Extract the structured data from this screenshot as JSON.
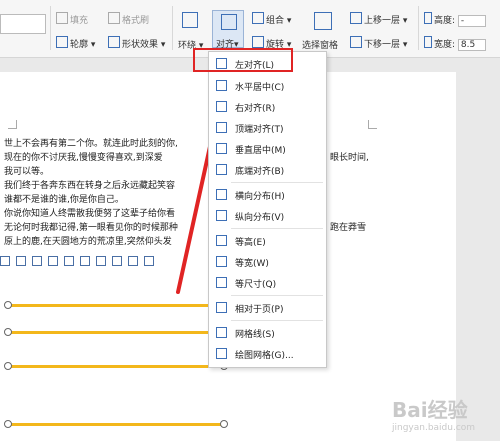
{
  "ribbon": {
    "fill_label": "填充",
    "format_brush_label": "格式刷",
    "outline_label": "轮廓",
    "shape_effect_label": "形状效果",
    "surround_label": "环绕",
    "align_label": "对齐",
    "combine_label": "组合",
    "rotate_label": "旋转",
    "selection_pane_label": "选择窗格",
    "up_layer_label": "上移一层",
    "down_layer_label": "下移一层",
    "height_label": "高度:",
    "width_label": "宽度:",
    "height_value": "-",
    "width_value": "8.5"
  },
  "document": {
    "lines": [
      "世上不会再有第二个你。就连此时此刻的你,",
      "现在的你不讨厌我,慢慢变得喜欢,到深爱",
      "我可以等。",
      "我们终于各奔东西在转身之后永远藏起笑容",
      "谁都不是谁的谁,你是你自己。",
      "你说你知道人终需散我便努了这辈子给你看",
      "无论何时我都记得,第一眼看见你的时候那种",
      "原上的鹿,在天圆地方的荒凉里,突然仰头发"
    ],
    "line_right_fragments": [
      "眼长时间,",
      "跑在莽雪"
    ]
  },
  "align_menu": {
    "items": [
      {
        "label": "左对齐(L)",
        "icon": "align-left-icon"
      },
      {
        "label": "水平居中(C)",
        "icon": "align-center-horizontal-icon"
      },
      {
        "label": "右对齐(R)",
        "icon": "align-right-icon"
      },
      {
        "label": "顶端对齐(T)",
        "icon": "align-top-icon"
      },
      {
        "label": "垂直居中(M)",
        "icon": "align-middle-vertical-icon"
      },
      {
        "label": "底端对齐(B)",
        "icon": "align-bottom-icon"
      },
      {
        "label": "横向分布(H)",
        "icon": "distribute-horizontal-icon"
      },
      {
        "label": "纵向分布(V)",
        "icon": "distribute-vertical-icon"
      },
      {
        "label": "等高(E)",
        "icon": "same-height-icon"
      },
      {
        "label": "等宽(W)",
        "icon": "same-width-icon"
      },
      {
        "label": "等尺寸(Q)",
        "icon": "same-size-icon"
      },
      {
        "label": "相对于页(P)",
        "icon": "relative-to-page-icon"
      },
      {
        "label": "网格线(S)",
        "icon": "gridlines-icon"
      },
      {
        "label": "绘图网格(G)...",
        "icon": "drawing-grid-icon"
      }
    ]
  },
  "watermark": {
    "text": "Bai经验",
    "sub": "jingyan.baidu.com"
  },
  "colors": {
    "accent": "#3d6fb6",
    "highlight_red": "#e02424",
    "line_yellow": "#f3b71b"
  }
}
